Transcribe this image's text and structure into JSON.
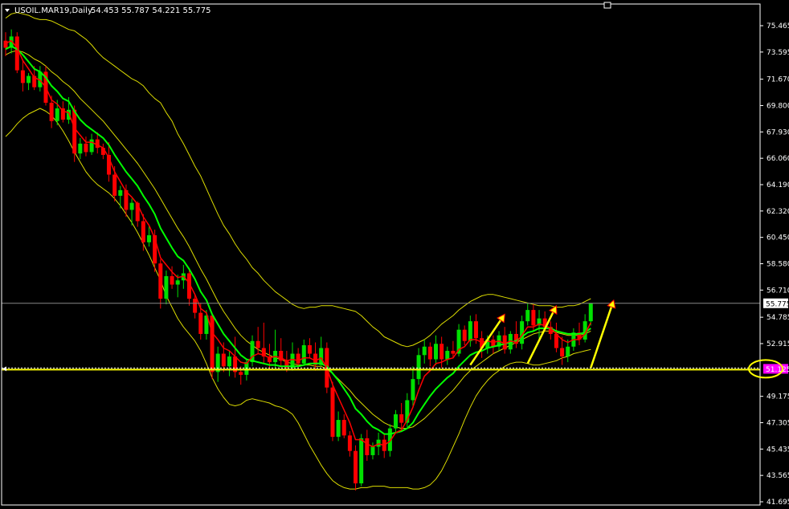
{
  "header": {
    "symbol_label": "USOIL.MAR19,Daily",
    "ohlc_label": "54.453 55.787 54.221 55.775"
  },
  "colors": {
    "background": "#000000",
    "frame": "#ffffff",
    "bull_candle": "#00e000",
    "bear_candle": "#ff0000",
    "fast_ma": "#ff0000",
    "slow_ma": "#00ff00",
    "bollinger": "#dcdc00",
    "support_line": "#ffff00",
    "arrows": "#ffff00",
    "price_tag_current": "#ffffff",
    "price_tag_support": "#ff00ff"
  },
  "chart_data": {
    "type": "candlestick",
    "symbol": "USOIL.MAR19",
    "timeframe": "Daily",
    "grid": false,
    "ylim": [
      41.695,
      76.4
    ],
    "y_ticks": [
      "75.465",
      "73.595",
      "71.670",
      "69.800",
      "67.930",
      "66.060",
      "64.190",
      "62.320",
      "60.450",
      "58.580",
      "56.710",
      "54.785",
      "52.915",
      "49.175",
      "47.305",
      "45.435",
      "43.565",
      "41.695"
    ],
    "current_price_label": "55.775",
    "current_price": 55.775,
    "support_label": "51.125",
    "support_level": 51.125,
    "candles": [
      [
        74.4,
        75.0,
        73.3,
        73.9
      ],
      [
        73.9,
        75.2,
        73.5,
        74.7
      ],
      [
        74.7,
        75.0,
        72.1,
        72.3
      ],
      [
        72.3,
        73.0,
        70.8,
        71.4
      ],
      [
        71.4,
        72.1,
        70.9,
        71.9
      ],
      [
        71.9,
        72.6,
        70.9,
        71.1
      ],
      [
        71.1,
        72.6,
        70.8,
        72.2
      ],
      [
        72.2,
        72.6,
        69.8,
        70.0
      ],
      [
        70.0,
        70.5,
        68.2,
        68.7
      ],
      [
        68.7,
        70.2,
        68.4,
        69.6
      ],
      [
        69.6,
        70.1,
        68.6,
        68.8
      ],
      [
        68.8,
        70.4,
        68.5,
        69.5
      ],
      [
        69.5,
        69.8,
        65.8,
        66.4
      ],
      [
        66.4,
        67.5,
        66.0,
        67.1
      ],
      [
        67.1,
        67.6,
        66.2,
        66.5
      ],
      [
        66.5,
        67.8,
        66.3,
        67.4
      ],
      [
        67.4,
        67.9,
        66.4,
        66.8
      ],
      [
        66.8,
        67.1,
        66.0,
        66.3
      ],
      [
        66.3,
        67.2,
        64.4,
        64.9
      ],
      [
        64.9,
        65.5,
        63.0,
        63.4
      ],
      [
        63.4,
        64.1,
        62.5,
        63.8
      ],
      [
        63.8,
        64.2,
        61.9,
        62.4
      ],
      [
        62.4,
        63.2,
        61.3,
        62.9
      ],
      [
        62.9,
        63.0,
        61.2,
        61.6
      ],
      [
        61.6,
        62.1,
        59.5,
        60.1
      ],
      [
        60.1,
        61.3,
        59.8,
        60.6
      ],
      [
        60.6,
        61.0,
        58.0,
        58.6
      ],
      [
        58.6,
        58.9,
        55.4,
        56.1
      ],
      [
        56.1,
        58.1,
        55.7,
        57.7
      ],
      [
        57.7,
        58.4,
        56.8,
        57.1
      ],
      [
        57.1,
        57.8,
        56.2,
        57.4
      ],
      [
        57.4,
        58.5,
        56.8,
        57.9
      ],
      [
        57.9,
        58.2,
        55.6,
        56.1
      ],
      [
        56.1,
        56.4,
        54.7,
        55.1
      ],
      [
        55.1,
        55.8,
        53.2,
        53.6
      ],
      [
        53.6,
        55.3,
        53.2,
        54.9
      ],
      [
        54.9,
        55.1,
        50.4,
        50.9
      ],
      [
        50.9,
        52.7,
        50.2,
        52.2
      ],
      [
        52.2,
        53.0,
        50.9,
        51.3
      ],
      [
        51.3,
        52.4,
        50.6,
        52.0
      ],
      [
        52.0,
        53.4,
        50.5,
        50.9
      ],
      [
        50.9,
        51.3,
        50.0,
        50.7
      ],
      [
        50.7,
        51.8,
        50.3,
        51.6
      ],
      [
        51.6,
        53.5,
        51.3,
        53.1
      ],
      [
        53.1,
        54.1,
        52.2,
        52.6
      ],
      [
        52.6,
        54.4,
        51.5,
        52.0
      ],
      [
        52.0,
        52.9,
        51.1,
        51.6
      ],
      [
        51.6,
        53.9,
        51.2,
        52.4
      ],
      [
        52.4,
        53.3,
        51.2,
        51.7
      ],
      [
        51.7,
        52.4,
        50.9,
        51.2
      ],
      [
        51.2,
        53.0,
        51.0,
        52.2
      ],
      [
        52.2,
        52.6,
        51.1,
        51.5
      ],
      [
        51.5,
        53.2,
        51.4,
        52.8
      ],
      [
        52.8,
        53.3,
        51.9,
        52.2
      ],
      [
        52.2,
        53.0,
        51.0,
        51.4
      ],
      [
        51.4,
        53.4,
        51.3,
        52.6
      ],
      [
        52.6,
        53.0,
        49.4,
        49.8
      ],
      [
        49.8,
        50.2,
        46.0,
        46.3
      ],
      [
        46.3,
        48.1,
        46.0,
        47.5
      ],
      [
        47.5,
        47.9,
        46.2,
        46.4
      ],
      [
        46.4,
        46.7,
        44.9,
        45.3
      ],
      [
        45.3,
        45.7,
        42.5,
        43.0
      ],
      [
        43.0,
        46.5,
        42.8,
        46.2
      ],
      [
        46.2,
        46.8,
        44.6,
        45.0
      ],
      [
        45.0,
        45.9,
        44.7,
        45.6
      ],
      [
        45.6,
        46.6,
        45.0,
        46.1
      ],
      [
        46.1,
        46.5,
        44.8,
        45.3
      ],
      [
        45.3,
        47.2,
        44.9,
        46.9
      ],
      [
        46.9,
        48.2,
        46.6,
        47.9
      ],
      [
        47.9,
        48.7,
        46.9,
        47.3
      ],
      [
        47.3,
        49.4,
        47.0,
        48.9
      ],
      [
        48.9,
        51.3,
        48.5,
        50.4
      ],
      [
        50.4,
        52.6,
        50.0,
        52.1
      ],
      [
        52.1,
        53.2,
        51.5,
        52.7
      ],
      [
        52.7,
        53.0,
        51.3,
        51.8
      ],
      [
        51.8,
        53.5,
        51.4,
        52.9
      ],
      [
        52.9,
        53.4,
        51.2,
        51.8
      ],
      [
        51.8,
        52.7,
        51.4,
        52.4
      ],
      [
        52.4,
        53.1,
        51.9,
        52.2
      ],
      [
        52.2,
        54.3,
        52.0,
        53.9
      ],
      [
        53.9,
        54.2,
        52.8,
        53.1
      ],
      [
        53.1,
        54.9,
        52.7,
        54.5
      ],
      [
        54.5,
        55.0,
        52.9,
        53.3
      ],
      [
        53.3,
        53.8,
        51.9,
        52.6
      ],
      [
        52.6,
        53.5,
        52.2,
        53.2
      ],
      [
        53.2,
        53.5,
        52.2,
        52.7
      ],
      [
        52.7,
        53.8,
        52.4,
        53.5
      ],
      [
        53.5,
        54.1,
        52.2,
        52.5
      ],
      [
        52.5,
        53.8,
        52.2,
        53.6
      ],
      [
        53.6,
        54.5,
        52.6,
        52.9
      ],
      [
        52.9,
        54.9,
        52.5,
        54.5
      ],
      [
        54.5,
        55.8,
        54.2,
        55.3
      ],
      [
        55.3,
        55.7,
        53.8,
        54.2
      ],
      [
        54.2,
        55.3,
        53.2,
        54.7
      ],
      [
        54.7,
        55.2,
        53.8,
        54.1
      ],
      [
        54.1,
        54.5,
        53.2,
        53.6
      ],
      [
        53.6,
        54.4,
        52.3,
        52.6
      ],
      [
        52.6,
        53.4,
        51.4,
        52.0
      ],
      [
        52.0,
        53.2,
        51.6,
        52.7
      ],
      [
        52.7,
        54.0,
        52.4,
        53.7
      ],
      [
        53.7,
        54.4,
        52.8,
        53.2
      ],
      [
        53.2,
        55.0,
        53.0,
        54.5
      ],
      [
        54.5,
        55.8,
        54.2,
        55.775
      ]
    ],
    "fast_ma": [
      74.2,
      74.4,
      73.9,
      73.0,
      72.4,
      71.8,
      71.6,
      71.1,
      70.2,
      69.9,
      69.4,
      69.3,
      68.2,
      67.7,
      67.2,
      67.2,
      67.0,
      66.8,
      66.1,
      65.1,
      64.4,
      63.7,
      63.3,
      62.8,
      61.9,
      61.3,
      60.4,
      59.0,
      58.5,
      58.0,
      57.6,
      57.7,
      57.2,
      56.4,
      55.4,
      55.1,
      53.7,
      53.2,
      52.6,
      52.4,
      52.0,
      51.6,
      51.5,
      52.0,
      52.2,
      52.1,
      51.9,
      52.0,
      51.9,
      51.7,
      51.8,
      51.7,
      51.9,
      51.9,
      51.7,
      51.9,
      51.2,
      50.0,
      49.1,
      48.2,
      47.3,
      46.1,
      46.1,
      45.8,
      45.6,
      45.8,
      45.7,
      46.0,
      46.6,
      46.8,
      47.5,
      48.4,
      49.6,
      50.6,
      51.0,
      51.5,
      51.6,
      51.8,
      51.9,
      52.5,
      52.7,
      53.2,
      53.2,
      53.0,
      53.1,
      53.0,
      53.1,
      52.9,
      53.1,
      53.0,
      53.5,
      54.1,
      54.1,
      54.3,
      54.2,
      54.0,
      53.6,
      53.2,
      53.0,
      53.2,
      53.2,
      53.6,
      54.4
    ],
    "slow_ma": [
      73.8,
      74.0,
      73.8,
      73.4,
      72.9,
      72.4,
      72.2,
      71.8,
      71.2,
      70.8,
      70.3,
      70.1,
      69.4,
      68.8,
      68.4,
      68.1,
      67.8,
      67.5,
      67.0,
      66.3,
      65.7,
      65.1,
      64.6,
      64.1,
      63.4,
      62.8,
      62.1,
      61.1,
      60.4,
      59.7,
      59.1,
      58.8,
      58.2,
      57.5,
      56.6,
      56.0,
      55.0,
      54.3,
      53.6,
      53.1,
      52.6,
      52.1,
      51.8,
      51.7,
      51.6,
      51.5,
      51.4,
      51.4,
      51.3,
      51.3,
      51.3,
      51.3,
      51.4,
      51.5,
      51.5,
      51.5,
      51.3,
      50.8,
      50.3,
      49.7,
      49.1,
      48.3,
      47.9,
      47.4,
      47.0,
      46.8,
      46.5,
      46.5,
      46.6,
      46.7,
      46.9,
      47.3,
      48.0,
      48.6,
      49.2,
      49.7,
      50.1,
      50.5,
      50.8,
      51.3,
      51.7,
      52.1,
      52.3,
      52.4,
      52.6,
      52.7,
      52.8,
      52.9,
      53.0,
      53.1,
      53.4,
      53.7,
      53.8,
      54.0,
      54.0,
      54.0,
      53.8,
      53.7,
      53.6,
      53.6,
      53.6,
      53.7,
      54.0
    ],
    "bb_upper": [
      76.0,
      76.3,
      76.4,
      76.3,
      76.2,
      76.0,
      75.9,
      75.9,
      75.8,
      75.6,
      75.4,
      75.2,
      75.1,
      74.8,
      74.5,
      74.1,
      73.6,
      73.2,
      72.9,
      72.6,
      72.3,
      72.0,
      71.7,
      71.5,
      71.2,
      70.7,
      70.3,
      70.0,
      69.3,
      68.7,
      67.8,
      67.1,
      66.3,
      65.5,
      64.8,
      63.9,
      63.0,
      62.1,
      61.3,
      60.7,
      60.0,
      59.4,
      58.9,
      58.3,
      57.9,
      57.4,
      57.0,
      56.6,
      56.3,
      56.0,
      55.7,
      55.5,
      55.4,
      55.5,
      55.5,
      55.6,
      55.6,
      55.6,
      55.5,
      55.4,
      55.3,
      55.2,
      54.9,
      54.5,
      54.1,
      53.8,
      53.4,
      53.2,
      53.0,
      52.8,
      52.7,
      52.8,
      53.0,
      53.2,
      53.5,
      53.9,
      54.3,
      54.6,
      54.9,
      55.3,
      55.6,
      55.9,
      56.1,
      56.3,
      56.4,
      56.4,
      56.3,
      56.2,
      56.1,
      56.0,
      55.9,
      55.8,
      55.7,
      55.6,
      55.6,
      55.6,
      55.5,
      55.5,
      55.6,
      55.6,
      55.7,
      55.9,
      56.1
    ],
    "bb_mid": [
      73.4,
      73.6,
      73.7,
      73.6,
      73.4,
      73.1,
      72.9,
      72.6,
      72.2,
      71.9,
      71.5,
      71.2,
      70.8,
      70.3,
      69.9,
      69.5,
      69.1,
      68.7,
      68.2,
      67.7,
      67.2,
      66.7,
      66.2,
      65.7,
      65.1,
      64.5,
      63.9,
      63.2,
      62.5,
      61.8,
      61.1,
      60.5,
      59.8,
      59.0,
      58.2,
      57.5,
      56.7,
      55.9,
      55.2,
      54.6,
      54.0,
      53.5,
      53.1,
      52.8,
      52.5,
      52.3,
      52.1,
      51.9,
      51.8,
      51.6,
      51.5,
      51.4,
      51.4,
      51.4,
      51.3,
      51.3,
      51.1,
      50.8,
      50.4,
      50.0,
      49.6,
      49.1,
      48.7,
      48.3,
      47.9,
      47.6,
      47.3,
      47.1,
      47.0,
      46.9,
      46.9,
      47.0,
      47.3,
      47.6,
      48.0,
      48.4,
      48.8,
      49.2,
      49.6,
      50.1,
      50.6,
      51.0,
      51.3,
      51.6,
      51.9,
      52.2,
      52.4,
      52.6,
      52.8,
      53.0,
      53.2,
      53.4,
      53.6,
      53.7,
      53.8,
      53.8,
      53.7,
      53.6,
      53.5,
      53.5,
      53.5,
      53.6,
      53.8
    ],
    "bb_lower": [
      67.6,
      68.0,
      68.5,
      68.9,
      69.2,
      69.4,
      69.6,
      69.4,
      69.1,
      68.6,
      68.0,
      67.3,
      66.5,
      65.8,
      65.1,
      64.6,
      64.2,
      63.9,
      63.6,
      63.2,
      62.7,
      62.1,
      61.5,
      60.8,
      60.0,
      59.2,
      58.3,
      57.4,
      56.3,
      55.5,
      54.7,
      54.1,
      53.6,
      53.1,
      52.4,
      51.5,
      50.5,
      49.7,
      49.1,
      48.6,
      48.5,
      48.6,
      48.9,
      49.0,
      48.9,
      48.8,
      48.7,
      48.5,
      48.4,
      48.2,
      47.9,
      47.3,
      46.5,
      45.7,
      45.0,
      44.3,
      43.7,
      43.2,
      42.9,
      42.7,
      42.6,
      42.6,
      42.7,
      42.7,
      42.8,
      42.8,
      42.8,
      42.7,
      42.7,
      42.7,
      42.7,
      42.6,
      42.6,
      42.7,
      42.9,
      43.3,
      43.9,
      44.7,
      45.6,
      46.5,
      47.5,
      48.4,
      49.2,
      49.8,
      50.3,
      50.7,
      51.0,
      51.3,
      51.5,
      51.6,
      51.6,
      51.5,
      51.4,
      51.4,
      51.5,
      51.6,
      51.7,
      51.9,
      52.0,
      52.2,
      52.3,
      52.4,
      52.5
    ],
    "arrows": [
      {
        "from_index": 81,
        "from_price": 51.4,
        "to_index": 87,
        "to_price": 55.0
      },
      {
        "from_index": 91,
        "from_price": 51.5,
        "to_index": 96,
        "to_price": 55.6
      },
      {
        "from_index": 102,
        "from_price": 51.2,
        "to_index": 106,
        "to_price": 56.0
      }
    ]
  }
}
